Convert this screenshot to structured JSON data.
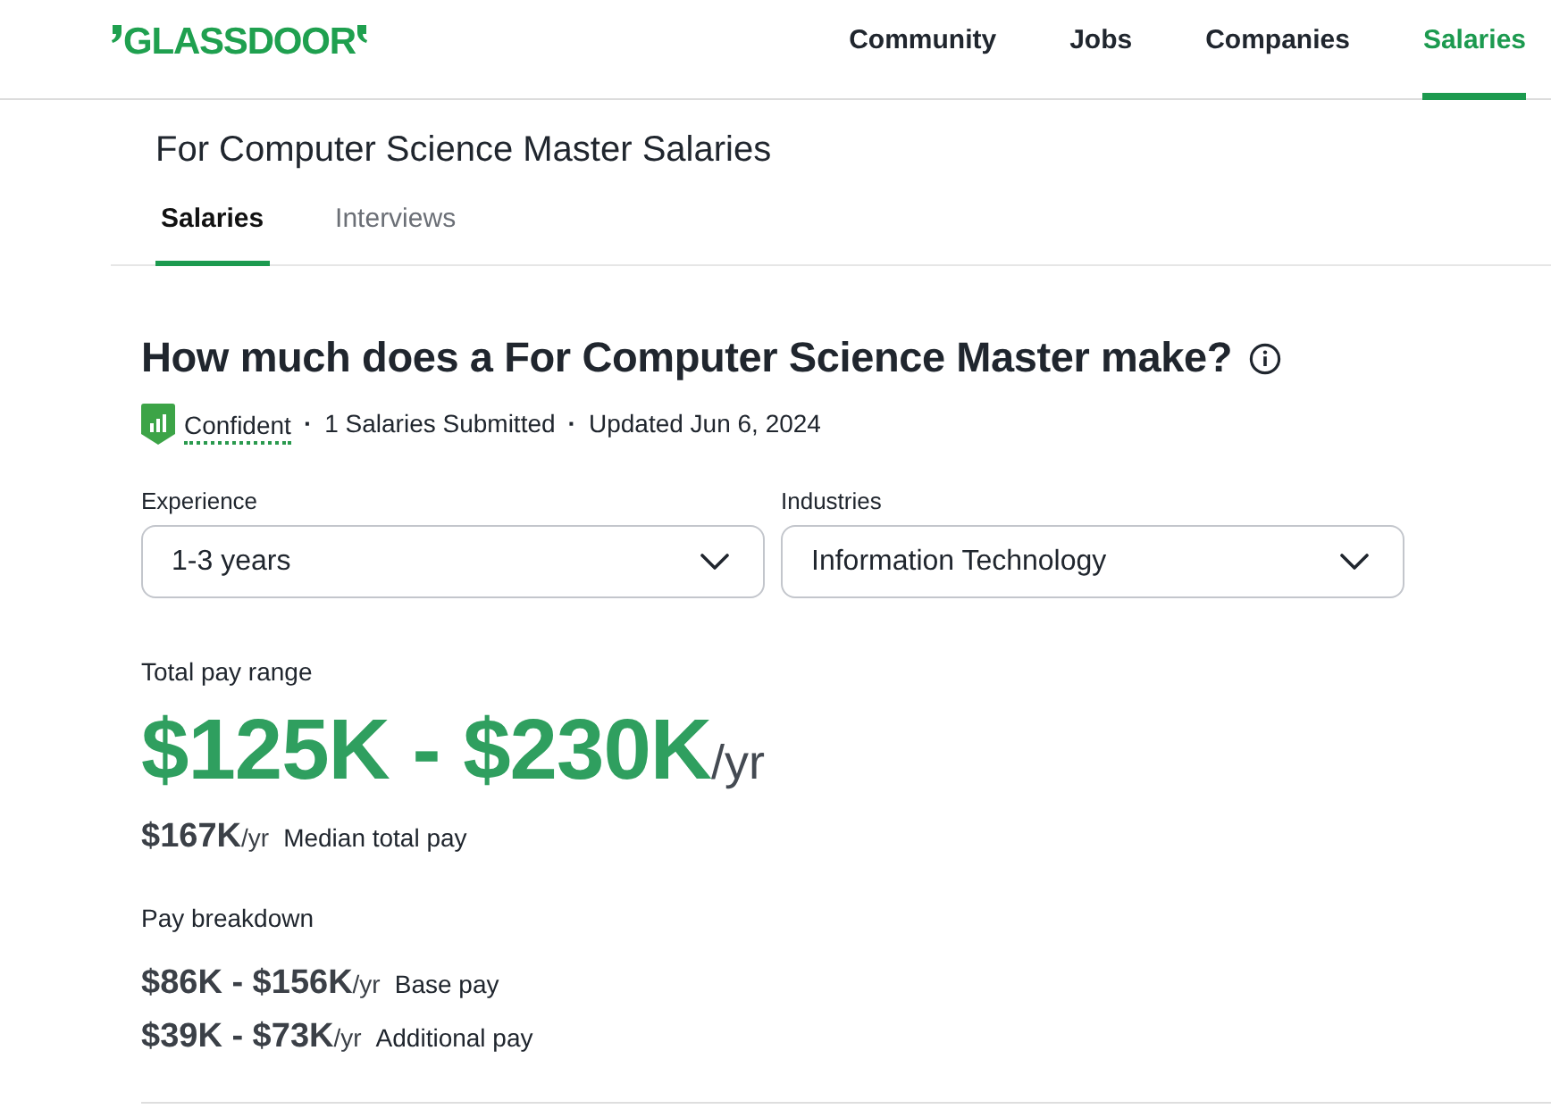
{
  "header": {
    "logo": "GLASSDOOR",
    "nav": [
      {
        "label": "Community",
        "selected": false
      },
      {
        "label": "Jobs",
        "selected": false
      },
      {
        "label": "Companies",
        "selected": false
      },
      {
        "label": "Salaries",
        "selected": true
      }
    ]
  },
  "page_title": "For Computer Science Master Salaries",
  "tabs": [
    {
      "label": "Salaries",
      "selected": true
    },
    {
      "label": "Interviews",
      "selected": false
    }
  ],
  "question": "How much does a For Computer Science Master make?",
  "meta": [
    {
      "kind": "confidence",
      "text": "Confident"
    },
    {
      "kind": "separator",
      "text": "·"
    },
    {
      "kind": "text",
      "text": "1 Salaries Submitted"
    },
    {
      "kind": "separator",
      "text": "·"
    },
    {
      "kind": "text",
      "text": "Updated Jun 6, 2024"
    }
  ],
  "filters": [
    {
      "label": "Experience",
      "value": "1-3 years"
    },
    {
      "label": "Industries",
      "value": "Information Technology"
    }
  ],
  "total_pay": {
    "label": "Total pay range",
    "range": "$125K - $230K",
    "unit": "/yr"
  },
  "median": {
    "amount": "$167K",
    "unit": "/yr",
    "label": "Median total pay"
  },
  "breakdown": {
    "title": "Pay breakdown",
    "rows": [
      {
        "range": "$86K - $156K",
        "unit": "/yr",
        "label": "Base pay"
      },
      {
        "range": "$39K - $73K",
        "unit": "/yr",
        "label": "Additional pay"
      }
    ]
  }
}
